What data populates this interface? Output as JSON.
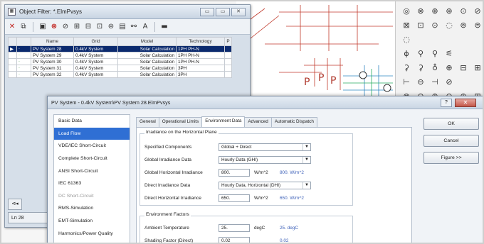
{
  "palette": {
    "icons": [
      "◎",
      "⊗",
      "⊕",
      "⊛",
      "⊙",
      "⊘",
      "⊠",
      "⊡",
      "⊙",
      "◌",
      "⊚",
      "⊜",
      "◌",
      "",
      "",
      "",
      "",
      "",
      "ϕ",
      "⚲",
      "⚲",
      "⚟",
      "",
      "",
      "⚳",
      "⚳",
      "♁",
      "⊕",
      "⊟",
      "⊞",
      "⊢",
      "⊖",
      "⊣",
      "⊘",
      "",
      "",
      " ⊗",
      "⊖",
      "⊕",
      "⊖",
      "⊕",
      "⊞"
    ]
  },
  "filter_window": {
    "title": "Object Filter: *.ElmPvsys",
    "controls": [
      "▭",
      "▭",
      "✕"
    ],
    "toolbar": [
      "✕",
      "⧉",
      "▣",
      "⊗",
      "⊘",
      "⊞",
      "⊟",
      "⊡",
      "⊜",
      "▤",
      "⚯",
      "A",
      "▬"
    ],
    "columns": [
      "",
      "",
      "Name",
      "Grid",
      "Model",
      "Technology",
      "P"
    ],
    "rows": [
      {
        "marker": "▶",
        "flag": "ᐧ",
        "name": "PV System 28",
        "grid": "0.4kV System",
        "model": "Solar Calculation",
        "tech": "1PH PH-N",
        "selected": true
      },
      {
        "marker": "",
        "flag": "ᐧ",
        "name": "PV System 29",
        "grid": "0.4kV System",
        "model": "Solar Calculation",
        "tech": "1PH PH-N",
        "selected": false
      },
      {
        "marker": "",
        "flag": "ᐧ",
        "name": "PV System 30",
        "grid": "0.4kV System",
        "model": "Solar Calculation",
        "tech": "1PH PH-N",
        "selected": false
      },
      {
        "marker": "",
        "flag": "ᐧ",
        "name": "PV System 31",
        "grid": "0.4kV System",
        "model": "Solar Calculation",
        "tech": "3PH",
        "selected": false
      },
      {
        "marker": "",
        "flag": "ᐧ",
        "name": "PV System 32",
        "grid": "0.4kV System",
        "model": "Solar Calculation",
        "tech": "3PH",
        "selected": false
      }
    ],
    "status": "Ln 28"
  },
  "dialog": {
    "title": "PV System - 0.4kV System\\PV System 28.ElmPvsys",
    "nav": [
      {
        "label": "Basic Data",
        "state": "normal"
      },
      {
        "label": "Load Flow",
        "state": "selected"
      },
      {
        "label": "VDE/IEC Short-Circuit",
        "state": "normal"
      },
      {
        "label": "Complete Short-Circuit",
        "state": "normal"
      },
      {
        "label": "ANSI Short-Circuit",
        "state": "normal"
      },
      {
        "label": "IEC 61363",
        "state": "normal"
      },
      {
        "label": "DC Short-Circuit",
        "state": "dim"
      },
      {
        "label": "RMS-Simulation",
        "state": "normal"
      },
      {
        "label": "EMT-Simulation",
        "state": "normal"
      },
      {
        "label": "Harmonics/Power Quality",
        "state": "normal"
      }
    ],
    "tabs": [
      {
        "label": "General",
        "active": false
      },
      {
        "label": "Operational Limits",
        "active": false
      },
      {
        "label": "Environment Data",
        "active": true
      },
      {
        "label": "Advanced",
        "active": false
      },
      {
        "label": "Automatic Dispatch",
        "active": false
      }
    ],
    "irradiance_group": {
      "title": "Irradiance on the Horizontal Plane",
      "specified_components": {
        "label": "Specified Components",
        "value": "Global + Direct"
      },
      "global_data": {
        "label": "Global Irradiance Data",
        "value": "Hourly Data (GHI)"
      },
      "global_horizontal": {
        "label": "Global Horizontal Irradiance",
        "value": "800.",
        "unit": "W/m^2",
        "calc": "800. W/m^2"
      },
      "direct_data": {
        "label": "Direct Irradiance Data",
        "value": "Hourly Data, Horizontal (DHI)"
      },
      "direct_horizontal": {
        "label": "Direct Horizontal Irradiance",
        "value": "650.",
        "unit": "W/m^2",
        "calc": "650. W/m^2"
      }
    },
    "environment_group": {
      "title": "Environment Factors",
      "ambient": {
        "label": "Ambient Temperature",
        "value": "25.",
        "unit": "degC",
        "calc": "25. degC"
      },
      "shading": {
        "label": "Shading Factor (Direct)",
        "value": "0.02",
        "calc": "0.02"
      }
    },
    "buttons": {
      "ok": "OK",
      "cancel": "Cancel",
      "figure": "Figure >>"
    },
    "close_glyph": "✕",
    "help_glyph": "?"
  }
}
